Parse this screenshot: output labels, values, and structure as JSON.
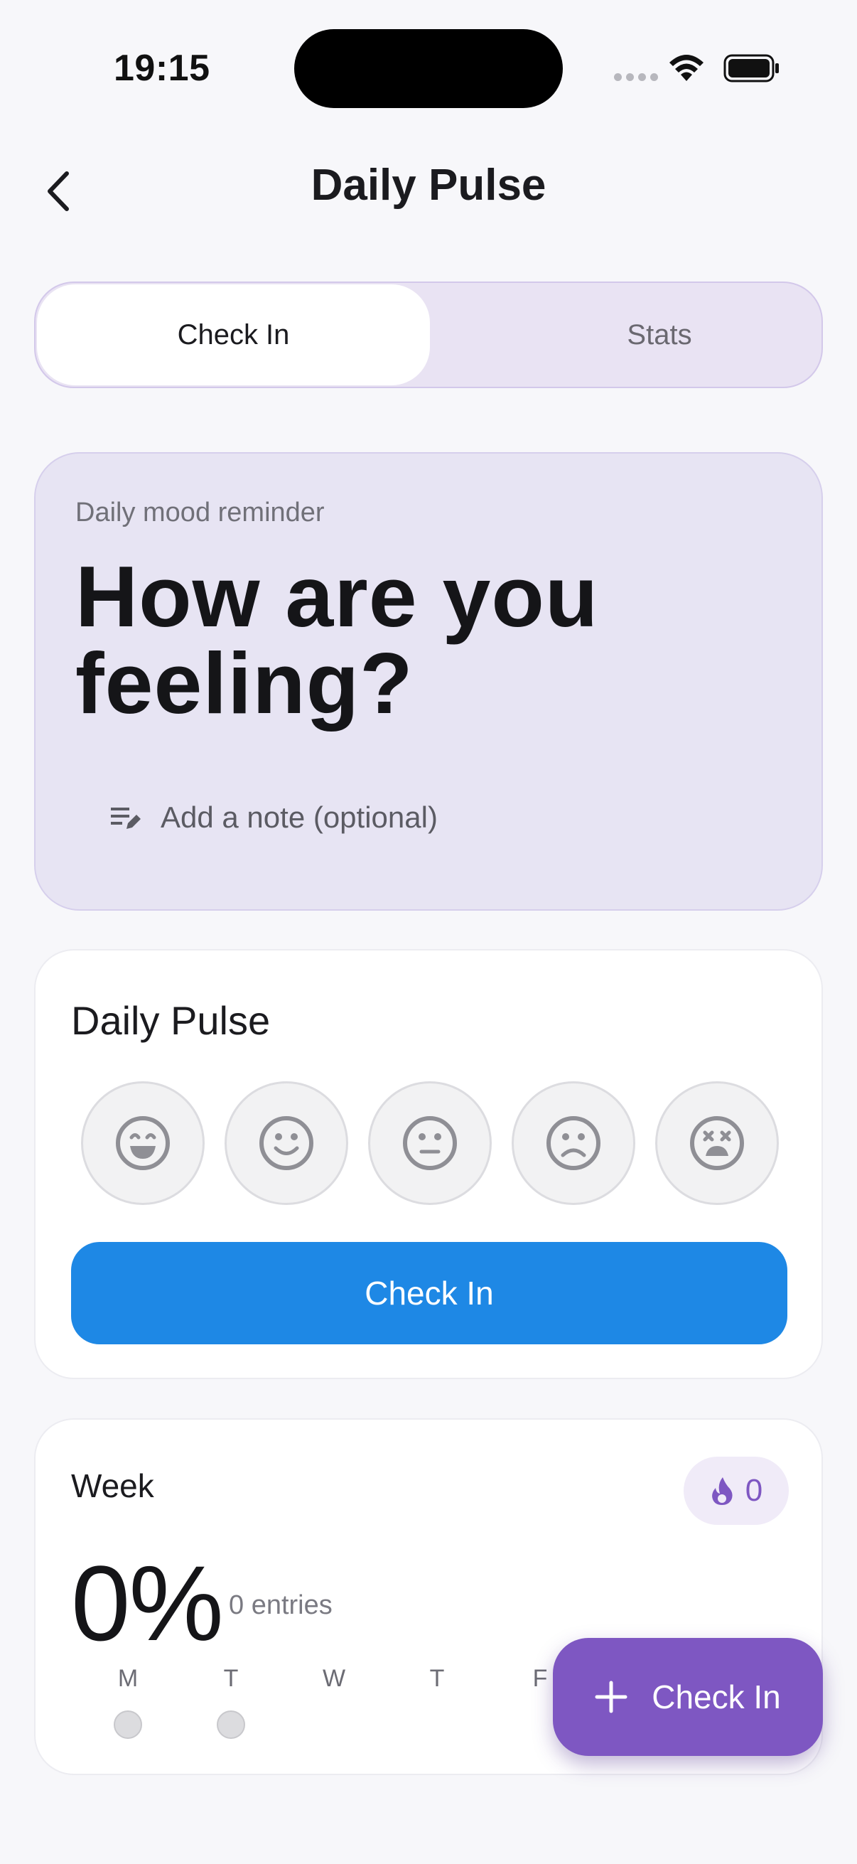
{
  "status_bar": {
    "time": "19:15"
  },
  "header": {
    "title": "Daily Pulse",
    "back_icon": "chevron-left-icon"
  },
  "segmented": {
    "tabs": [
      {
        "label": "Check In",
        "active": true
      },
      {
        "label": "Stats",
        "active": false
      }
    ]
  },
  "prompt_card": {
    "subtitle": "Daily mood reminder",
    "title": "How are you feeling?",
    "note_placeholder": "Add a note (optional)",
    "note_icon": "edit-note-icon"
  },
  "pulse_card": {
    "title": "Daily Pulse",
    "moods": [
      "very-happy-face-icon",
      "happy-face-icon",
      "neutral-face-icon",
      "sad-face-icon",
      "very-sad-face-icon"
    ],
    "button_label": "Check In"
  },
  "week_card": {
    "title": "Week",
    "streak": "0",
    "streak_icon": "flame-icon",
    "percent": "0%",
    "entries": "0 entries",
    "days": [
      "M",
      "T",
      "W",
      "T",
      "F"
    ]
  },
  "fab": {
    "label": "Check In",
    "icon": "plus-icon"
  },
  "colors": {
    "accent_purple": "#7e57c2",
    "primary_blue": "#1e88e5",
    "card_lavender": "#e7e4f3",
    "background": "#f7f7fa"
  }
}
